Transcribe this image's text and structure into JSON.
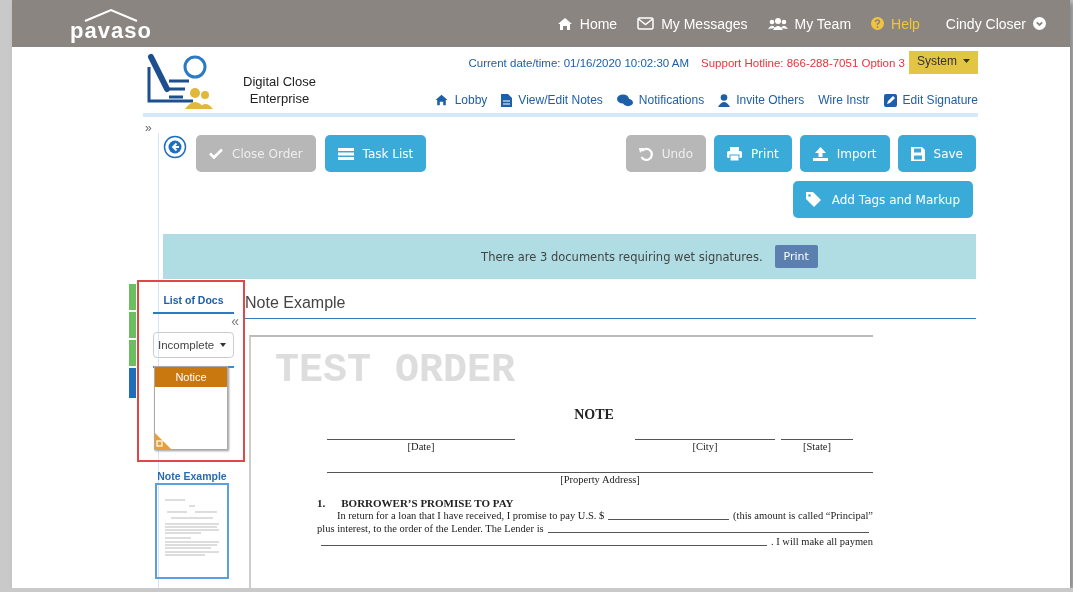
{
  "header": {
    "logo": "pavaso",
    "nav": [
      {
        "kind": "home",
        "label": "Home",
        "highlighted": false
      },
      {
        "kind": "envelope",
        "label": "My Messages",
        "highlighted": false
      },
      {
        "kind": "team",
        "label": "My Team",
        "highlighted": false
      },
      {
        "kind": "help",
        "label": "Help",
        "highlighted": true
      }
    ],
    "user": "Cindy Closer"
  },
  "app": {
    "name_lines": [
      "Digital Close",
      "Enterprise"
    ],
    "datetime": "Current date/time: 01/16/2020 10:02:30 AM",
    "hotline": "Support Hotline: 866-288-7051 Option 3",
    "system_menu": "System",
    "nav": [
      {
        "kind": "home",
        "label": "Lobby"
      },
      {
        "kind": "file",
        "label": "View/Edit Notes"
      },
      {
        "kind": "chat",
        "label": "Notifications"
      },
      {
        "kind": "user",
        "label": "Invite Others"
      },
      {
        "kind": "plain",
        "label": "Wire Instr"
      },
      {
        "kind": "edit",
        "label": "Edit Signature"
      }
    ]
  },
  "expand_toggle": "»",
  "toolbar": {
    "left": [
      {
        "kind": "check",
        "label": "Close Order",
        "disabled": true
      },
      {
        "kind": "list",
        "label": "Task List",
        "disabled": false
      }
    ],
    "right": [
      {
        "kind": "undo",
        "label": "Undo",
        "disabled": true
      },
      {
        "kind": "print",
        "label": "Print",
        "disabled": false
      },
      {
        "kind": "upload",
        "label": "Import",
        "disabled": false
      },
      {
        "kind": "save",
        "label": "Save",
        "disabled": false
      }
    ],
    "extra": [
      {
        "kind": "tag",
        "label": "Add Tags and Markup",
        "disabled": false
      }
    ]
  },
  "banner": {
    "message": "There are 3 documents requiring wet signatures.",
    "button": "Print"
  },
  "side_strips": [
    {
      "color": "#6cbf5e"
    },
    {
      "color": "#6cbf5e"
    },
    {
      "color": "#6cbf5e"
    },
    {
      "color": "#1f6fb8"
    }
  ],
  "doc_list": {
    "tab": "List of Docs",
    "collapse": "«",
    "filter": "Incomplete",
    "docs": [
      {
        "kind": "placeholder",
        "label": "Notice",
        "selected": false,
        "highlighted": true
      },
      {
        "kind": "page",
        "label": "Note Example",
        "selected": true,
        "highlighted": false
      }
    ]
  },
  "viewer": {
    "title": "Note Example",
    "document": {
      "watermark": "TEST ORDER",
      "heading": "NOTE",
      "place_fields": [
        "[Date]",
        "[City]",
        "[State]"
      ],
      "address_field": "[Property Address]",
      "section_number": "1.",
      "section_title": "BORROWER’S PROMISE TO PAY",
      "lines": [
        [
          {
            "kind": "text",
            "text": "In return for a loan that I have received, I promise to pay U.S. $"
          },
          {
            "kind": "blank"
          },
          {
            "kind": "text",
            "text": "(this amount is called “Principal”"
          }
        ],
        [
          {
            "kind": "text",
            "text": "plus interest, to the order of the Lender.  The Lender is"
          },
          {
            "kind": "blank"
          }
        ],
        [
          {
            "kind": "blank"
          },
          {
            "kind": "text",
            "text": ". I will make all paymen"
          }
        ]
      ]
    }
  }
}
